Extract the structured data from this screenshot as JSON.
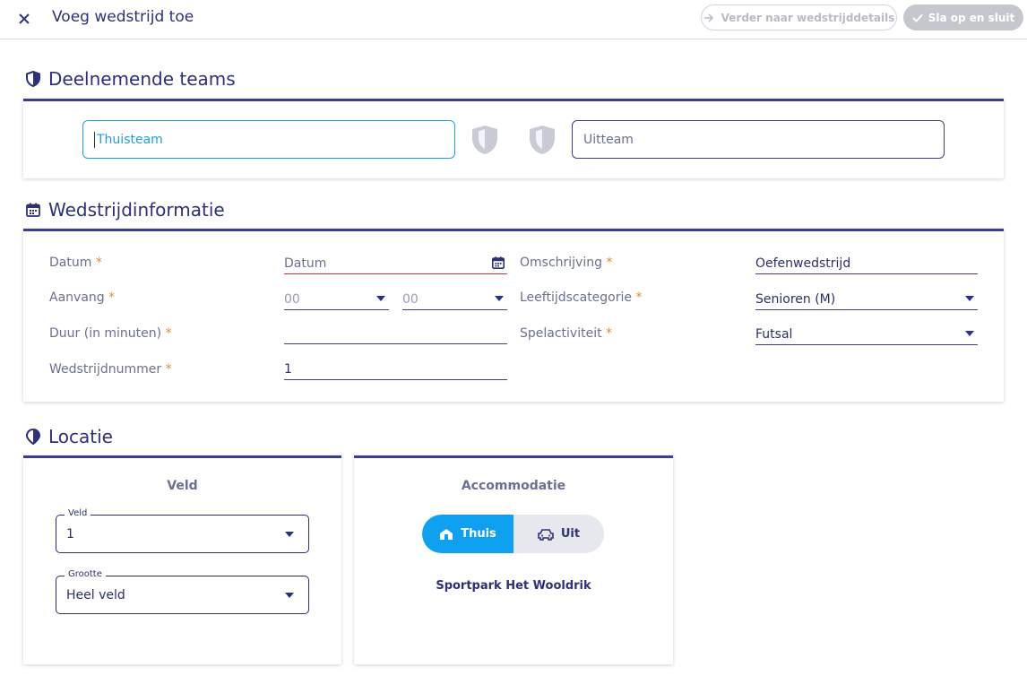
{
  "header": {
    "title": "Voeg wedstrijd toe",
    "next_label": "Verder naar wedstrijddetails",
    "save_label": "Sla op en sluit"
  },
  "teams": {
    "section_title": "Deelnemende teams",
    "home_placeholder": "Thuisteam",
    "away_placeholder": "Uitteam"
  },
  "match_info": {
    "section_title": "Wedstrijdinformatie",
    "date_label": "Datum",
    "date_value": "Datum",
    "start_label": "Aanvang",
    "hour_value": "00",
    "minute_value": "00",
    "duration_label": "Duur (in minuten)",
    "duration_value": "",
    "match_number_label": "Wedstrijdnummer",
    "match_number_value": "1",
    "description_label": "Omschrijving",
    "description_value": "Oefenwedstrijd",
    "age_category_label": "Leeftijdscategorie",
    "age_category_value": "Senioren (M)",
    "activity_label": "Spelactiviteit",
    "activity_value": "Futsal",
    "required_mark": "*"
  },
  "location": {
    "section_title": "Locatie",
    "field_title": "Veld",
    "field_legend": "Veld",
    "field_value": "1",
    "size_legend": "Grootte",
    "size_value": "Heel veld",
    "accommodation_title": "Accommodatie",
    "home_option": "Thuis",
    "away_option": "Uit",
    "selected_option": "Thuis",
    "venue_name": "Sportpark Het Wooldrik"
  },
  "colors": {
    "primary": "#2d3178",
    "accent": "#10a0f0",
    "required": "#e58a3b",
    "error": "#d62d3e"
  },
  "icons": [
    "close-icon",
    "arrow-right-icon",
    "check-icon",
    "shield-icon",
    "calendar-icon",
    "location-pin-icon",
    "chevron-down-icon",
    "home-icon",
    "car-icon"
  ]
}
